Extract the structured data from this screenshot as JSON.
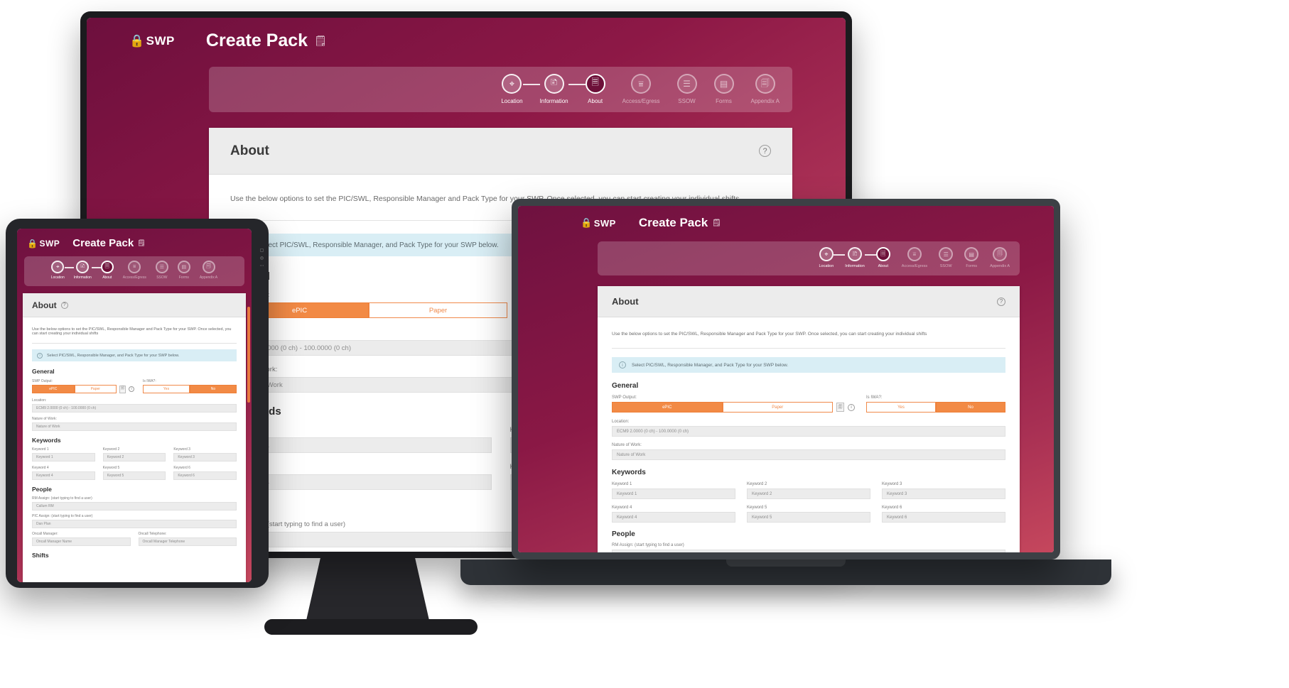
{
  "app": {
    "brand": "SWP",
    "title": "Create Pack",
    "brand_icon": "lock-icon",
    "title_icon": "pack-icon",
    "accent_orange": "#f28a45",
    "header_magenta": "#6d1039",
    "notice_blue": "#d9eef5"
  },
  "stepper": {
    "items": [
      {
        "label": "Location",
        "icon": "map-pin-icon",
        "state": "done"
      },
      {
        "label": "Information",
        "icon": "document-icon",
        "state": "done"
      },
      {
        "label": "About",
        "icon": "document-info-icon",
        "state": "active"
      },
      {
        "label": "Access/Egress",
        "icon": "barrier-icon",
        "state": "upcoming"
      },
      {
        "label": "SSOW",
        "icon": "stack-icon",
        "state": "upcoming"
      },
      {
        "label": "Forms",
        "icon": "form-icon",
        "state": "upcoming"
      },
      {
        "label": "Appendix A",
        "icon": "appendix-icon",
        "state": "upcoming"
      }
    ]
  },
  "page": {
    "heading": "About",
    "help_icon": "question-mark-icon",
    "intro": "Use the below options to set the PIC/SWL, Responsible Manager and Pack Type for your SWP. Once selected, you can start creating your individual shifts",
    "notice": "Select PIC/SWL, Responsible Manager, and Pack Type for your SWP below.",
    "notice_icon": "info-icon"
  },
  "general": {
    "heading": "General",
    "swp_output_label": "SWP Output:",
    "swp_output_options": [
      "ePIC",
      "Paper"
    ],
    "swp_output_selected": "ePIC",
    "output_side_icon": "copy-icon",
    "output_info_icon": "info-icon",
    "is_iwa_label": "Is IWA?:",
    "is_iwa_options": [
      "Yes",
      "No"
    ],
    "is_iwa_selected": "No",
    "location_label": "Location:",
    "location_value": "ECM9 2.0000 (0 ch) - 100.0000 (0 ch)",
    "nature_label": "Nature of Work:",
    "nature_value": "Nature of Work"
  },
  "keywords": {
    "heading": "Keywords",
    "fields": [
      {
        "label": "Keyword 1",
        "value": "Keyword 1"
      },
      {
        "label": "Keyword 2",
        "value": "Keyword 2"
      },
      {
        "label": "Keyword 3",
        "value": "Keyword 3"
      },
      {
        "label": "Keyword 4",
        "value": "Keyword 4"
      },
      {
        "label": "Keyword 5",
        "value": "Keyword 5"
      },
      {
        "label": "Keyword 6",
        "value": "Keyword 6"
      }
    ]
  },
  "people": {
    "heading": "People",
    "rm_label": "RM Assign: (start typing to find a user)",
    "rm_value": "Callum RM",
    "pic_label": "PIC Assign: (start typing to find a user)",
    "pic_value": "Dan Plan",
    "oncall_manager_label": "Oncall Manager:",
    "oncall_manager_value": "Oncall Manager Name",
    "oncall_telephone_label": "Oncall Telephone:",
    "oncall_telephone_value": "Oncall Manager Telephone"
  },
  "shifts": {
    "heading": "Shifts"
  }
}
